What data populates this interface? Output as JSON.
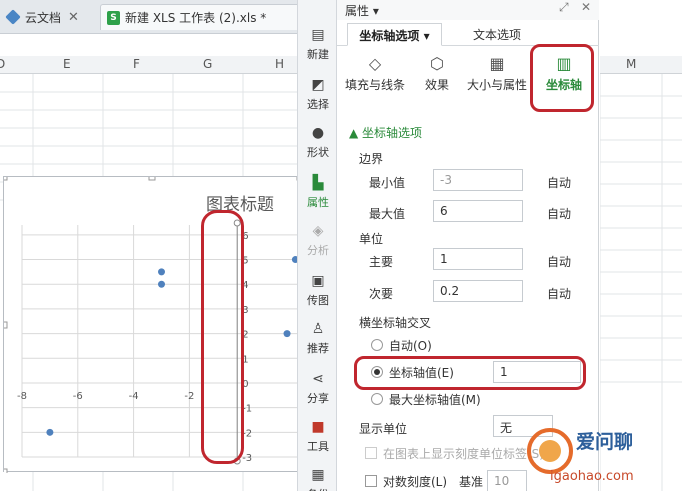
{
  "tabs": [
    {
      "label": "云文档",
      "active": false
    },
    {
      "label": "新建 XLS 工作表 (2).xls *",
      "active": true
    }
  ],
  "sheet": {
    "columns": [
      "D",
      "E",
      "F",
      "G",
      "H"
    ],
    "chart_title": "图表标题"
  },
  "right_sheet": {
    "column": "M"
  },
  "strip": [
    {
      "label": "新建",
      "icon": "new-icon",
      "state": "normal"
    },
    {
      "label": "选择",
      "icon": "select-icon",
      "state": "normal"
    },
    {
      "label": "形状",
      "icon": "shape-icon",
      "state": "normal"
    },
    {
      "label": "属性",
      "icon": "property-icon",
      "state": "active"
    },
    {
      "label": "分析",
      "icon": "analysis-icon",
      "state": "disabled"
    },
    {
      "label": "传图",
      "icon": "upload-image-icon",
      "state": "normal"
    },
    {
      "label": "推荐",
      "icon": "recommend-icon",
      "state": "normal"
    },
    {
      "label": "分享",
      "icon": "share-icon",
      "state": "normal"
    },
    {
      "label": "工具",
      "icon": "toolbox-icon",
      "state": "normal"
    },
    {
      "label": "备份",
      "icon": "backup-icon",
      "state": "normal"
    }
  ],
  "panel": {
    "title": "属性 ▾",
    "tab_axis": "坐标轴选项 ▾",
    "tab_text": "文本选项",
    "categories": [
      {
        "label": "填充与线条",
        "icon": "fill-icon"
      },
      {
        "label": "效果",
        "icon": "effect-icon"
      },
      {
        "label": "大小与属性",
        "icon": "size-icon"
      },
      {
        "label": "坐标轴",
        "icon": "axis-icon"
      }
    ],
    "section": "▲ 坐标轴选项",
    "bounds_label": "边界",
    "min_label": "最小值",
    "min_value": "-3",
    "max_label": "最大值",
    "max_value": "6",
    "auto": "自动",
    "units_label": "单位",
    "major_label": "主要",
    "major_value": "1",
    "minor_label": "次要",
    "minor_value": "0.2",
    "cross_label": "横坐标轴交叉",
    "opt_auto": "自动(O)",
    "opt_value": "坐标轴值(E)",
    "opt_value_input": "1",
    "opt_max": "最大坐标轴值(M)",
    "display_units_label": "显示单位",
    "display_units_value": "无",
    "show_units_label": "在图表上显示刻度单位标签(S)",
    "log_label": "对数刻度(L)",
    "base_label": "基准",
    "base_value": "10"
  },
  "watermark": {
    "text": "爱问聊",
    "url": "igaohao.com"
  },
  "chart_data": {
    "type": "scatter",
    "title": "图表标题",
    "xlabel": "",
    "ylabel": "",
    "x_ticks": [
      -8,
      -6,
      -4,
      -2
    ],
    "y_ticks": [
      6,
      5,
      4,
      3,
      2,
      1,
      0,
      -1,
      -2,
      -3
    ],
    "xlim": [
      -8,
      2
    ],
    "ylim": [
      -3,
      6.4
    ],
    "grid": true,
    "series": [
      {
        "points": [
          [
            -7,
            -2
          ],
          [
            -3,
            4.5
          ],
          [
            -3,
            4
          ],
          [
            1.8,
            5
          ],
          [
            1.5,
            2
          ],
          [
            2.3,
            3
          ]
        ]
      }
    ],
    "colors": {
      "marker": "#4f81bd",
      "grid": "#d9d9d9",
      "axis": "#808080"
    }
  }
}
